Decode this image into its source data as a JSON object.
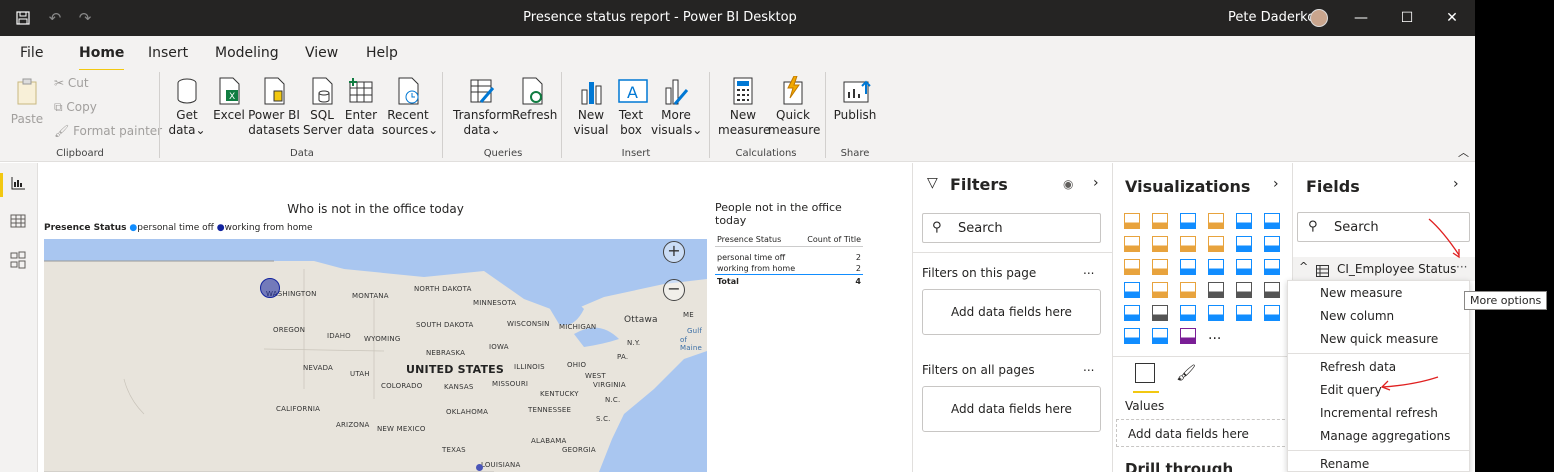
{
  "window": {
    "title": "Presence status report - Power BI Desktop",
    "user": "Pete Daderko"
  },
  "menu": {
    "tabs": [
      "File",
      "Home",
      "Insert",
      "Modeling",
      "View",
      "Help"
    ],
    "active": "Home"
  },
  "ribbon": {
    "clipboard": {
      "paste": "Paste",
      "cut": "Cut",
      "copy": "Copy",
      "format_painter": "Format painter",
      "label": "Clipboard"
    },
    "data": {
      "get_data": [
        "Get",
        "data"
      ],
      "excel": [
        "Excel",
        ""
      ],
      "powerbi": [
        "Power BI",
        "datasets"
      ],
      "sql": [
        "SQL",
        "Server"
      ],
      "enter": [
        "Enter",
        "data"
      ],
      "recent": [
        "Recent",
        "sources"
      ],
      "label": "Data"
    },
    "queries": {
      "transform": [
        "Transform",
        "data"
      ],
      "refresh": [
        "Refresh",
        ""
      ],
      "label": "Queries"
    },
    "insert": {
      "new_visual": [
        "New",
        "visual"
      ],
      "text_box": [
        "Text",
        "box"
      ],
      "more_visuals": [
        "More",
        "visuals"
      ],
      "label": "Insert"
    },
    "calculations": {
      "new_measure": [
        "New",
        "measure"
      ],
      "quick_measure": [
        "Quick",
        "measure"
      ],
      "label": "Calculations"
    },
    "share": {
      "publish": "Publish",
      "label": "Share"
    }
  },
  "report": {
    "map_title": "Who is not in the office today",
    "legend": {
      "title": "Presence Status",
      "items": [
        "personal time off",
        "working from home"
      ],
      "colors": [
        "#118dff",
        "#12239e"
      ]
    },
    "map_labels": {
      "washington": "WASHINGTON",
      "montana": "MONTANA",
      "north_dakota": "NORTH DAKOTA",
      "minnesota": "MINNESOTA",
      "oregon": "OREGON",
      "idaho": "IDAHO",
      "south_dakota": "SOUTH DAKOTA",
      "wisconsin": "WISCONSIN",
      "michigan": "MICHIGAN",
      "ottawa": "Ottawa",
      "maine": "ME",
      "gulf": [
        "Gulf",
        "of Maine"
      ],
      "wyoming": "WYOMING",
      "iowa": "IOWA",
      "nebraska": "NEBRASKA",
      "ny": "N.Y.",
      "pa": "PA.",
      "nevada": "NEVADA",
      "utah": "UTAH",
      "united_states": "UNITED STATES",
      "illinois": "ILLINOIS",
      "ohio": "OHIO",
      "california": "CALIFORNIA",
      "colorado": "COLORADO",
      "kansas": "KANSAS",
      "missouri": "MISSOURI",
      "west_virginia": "WEST",
      "virginia": "VIRGINIA",
      "kentucky": "KENTUCKY",
      "nc": "N.C.",
      "oklahoma": "OKLAHOMA",
      "tennessee": "TENNESSEE",
      "arizona": "ARIZONA",
      "new_mexico": "NEW MEXICO",
      "sc": "S.C.",
      "alabama": "ALABAMA",
      "georgia": "GEORGIA",
      "texas": "TEXAS",
      "louisiana": "LOUISIANA"
    },
    "table": {
      "title": "People not in the office today",
      "columns": [
        "Presence Status",
        "Count of Title"
      ],
      "rows": [
        [
          "personal time off",
          "2"
        ],
        [
          "working from home",
          "2"
        ]
      ],
      "total": [
        "Total",
        "4"
      ]
    }
  },
  "filters": {
    "title": "Filters",
    "search_placeholder": "Search",
    "on_this_page": "Filters on this page",
    "on_all_pages": "Filters on all pages",
    "add_fields": "Add data fields here",
    "more": "..."
  },
  "visualizations": {
    "title": "Visualizations",
    "values_label": "Values",
    "add_fields": "Add data fields here",
    "drill_through": "Drill through",
    "more": "..."
  },
  "fields": {
    "title": "Fields",
    "search_placeholder": "Search",
    "table_name": "CI_Employee Status",
    "more_options_tooltip": "More options",
    "context_menu": [
      "New measure",
      "New column",
      "New quick measure",
      "Refresh data",
      "Edit query",
      "Incremental refresh",
      "Manage aggregations",
      "Rename"
    ]
  }
}
